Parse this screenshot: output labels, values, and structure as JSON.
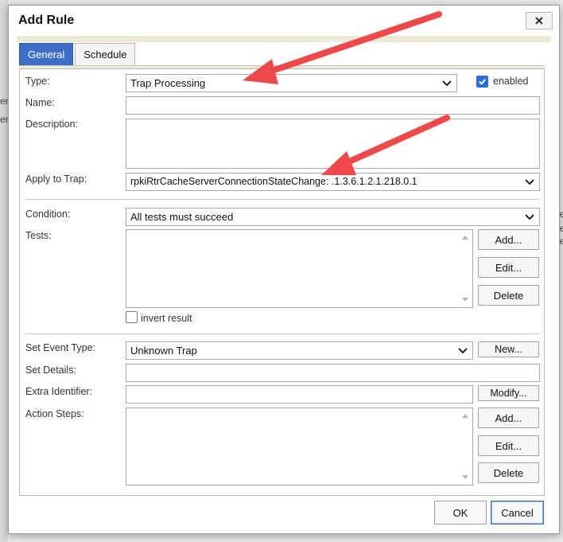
{
  "background": {
    "left_fragments": [
      "er",
      "er"
    ],
    "right_fragments": [
      "ne",
      "ne",
      "ne"
    ]
  },
  "dialog": {
    "title": "Add Rule",
    "close_icon": "close-icon",
    "tabs": [
      {
        "label": "General",
        "active": true
      },
      {
        "label": "Schedule",
        "active": false
      }
    ]
  },
  "general": {
    "type_label": "Type:",
    "type_value": "Trap Processing",
    "enabled_label": "enabled",
    "enabled_checked": true,
    "name_label": "Name:",
    "name_value": "",
    "description_label": "Description:",
    "description_value": "",
    "apply_label": "Apply to Trap:",
    "apply_value": "rpkiRtrCacheServerConnectionStateChange: .1.3.6.1.2.1.218.0.1",
    "condition_label": "Condition:",
    "condition_value": "All tests must succeed",
    "tests_label": "Tests:",
    "tests_buttons": {
      "add": "Add...",
      "edit": "Edit...",
      "delete": "Delete"
    },
    "invert_label": "invert result",
    "invert_checked": false,
    "set_event_type_label": "Set Event Type:",
    "set_event_type_value": "Unknown Trap",
    "new_button": "New...",
    "set_details_label": "Set Details:",
    "set_details_value": "",
    "extra_identifier_label": "Extra Identifier:",
    "extra_identifier_value": "",
    "modify_button": "Modify...",
    "action_steps_label": "Action Steps:",
    "action_buttons": {
      "add": "Add...",
      "edit": "Edit...",
      "delete": "Delete"
    }
  },
  "footer": {
    "ok": "OK",
    "cancel": "Cancel"
  },
  "colors": {
    "active_tab": "#3d6fc7",
    "annotation_arrow": "#f0474a",
    "checkbox": "#2b6ed3"
  }
}
